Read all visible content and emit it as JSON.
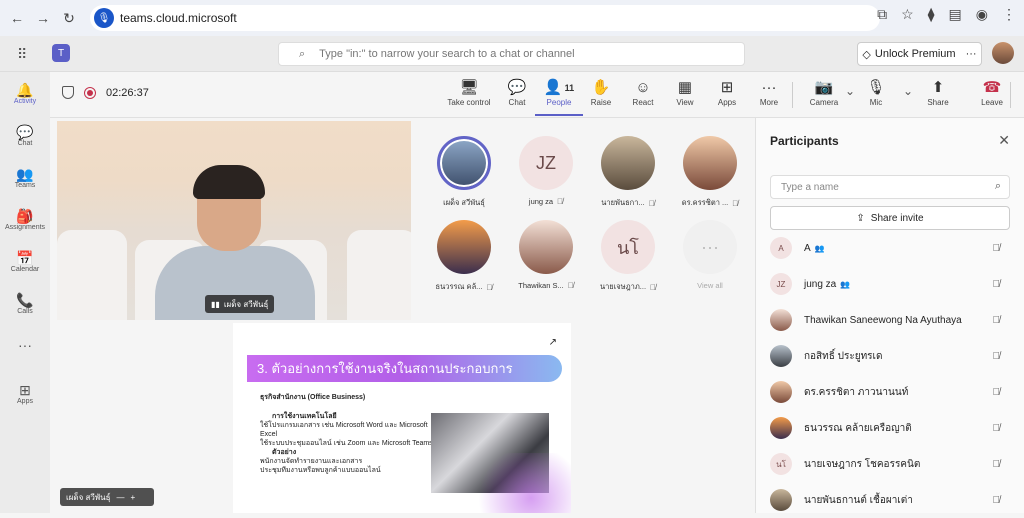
{
  "browser": {
    "url": "teams.cloud.microsoft",
    "nav_icons": [
      "back-icon",
      "forward-icon",
      "reload-icon"
    ],
    "right_icons": [
      "cast-icon",
      "star-icon",
      "extensions-icon",
      "tab-search-icon",
      "profile-icon",
      "menu-icon"
    ]
  },
  "teams": {
    "search_placeholder": "Type \"in:\" to narrow your search to a chat or channel",
    "premium_label": "Unlock Premium",
    "more_label": "···",
    "brand_color": "#5b5fc7"
  },
  "rail": [
    {
      "label": "Activity",
      "icon": "bell-icon",
      "glyph": "🔔",
      "active": true
    },
    {
      "label": "Chat",
      "icon": "chat-icon",
      "glyph": "💬",
      "active": false
    },
    {
      "label": "Teams",
      "icon": "teams-icon",
      "glyph": "👥",
      "active": false
    },
    {
      "label": "Assignments",
      "icon": "assignments-icon",
      "glyph": "🎒",
      "active": false
    },
    {
      "label": "Calendar",
      "icon": "calendar-icon",
      "glyph": "📅",
      "active": false
    },
    {
      "label": "Calls",
      "icon": "phone-icon",
      "glyph": "📞",
      "active": false
    },
    {
      "label": "",
      "icon": "more-apps-icon",
      "glyph": "···",
      "active": false
    },
    {
      "label": "Apps",
      "icon": "apps-icon",
      "glyph": "⊞",
      "active": false
    }
  ],
  "meeting": {
    "timer": "02:26:37",
    "people_count": "11",
    "tools": [
      {
        "label": "Take control",
        "icon": "take-control-icon",
        "glyph": "🖥"
      },
      {
        "label": "Chat",
        "icon": "chat-icon",
        "glyph": "💬"
      },
      {
        "label": "People",
        "icon": "people-icon",
        "glyph": "👤"
      },
      {
        "label": "Raise",
        "icon": "raise-hand-icon",
        "glyph": "✋"
      },
      {
        "label": "React",
        "icon": "react-icon",
        "glyph": "☺"
      },
      {
        "label": "View",
        "icon": "view-icon",
        "glyph": "▦"
      },
      {
        "label": "Apps",
        "icon": "apps-icon",
        "glyph": "⊞"
      },
      {
        "label": "More",
        "icon": "more-icon",
        "glyph": "···"
      },
      {
        "label": "Camera",
        "icon": "camera-off-icon",
        "glyph": "📷"
      },
      {
        "label": "Mic",
        "icon": "mic-off-icon",
        "glyph": "🎙"
      },
      {
        "label": "Share",
        "icon": "share-icon",
        "glyph": "⬆"
      },
      {
        "label": "Leave",
        "icon": "leave-phone-icon",
        "glyph": "☎"
      }
    ]
  },
  "stage": {
    "main_speaker_name": "เผด็จ สวีพันธุ์",
    "self_name": "เผด็จ สวีพันธุ์",
    "gallery": [
      {
        "name": "เผด็จ สวีพันธุ์",
        "initials": "",
        "selected": true,
        "muted": false
      },
      {
        "name": "jung za",
        "initials": "JZ",
        "selected": false,
        "muted": true
      },
      {
        "name": "นายพันธกา...",
        "initials": "",
        "selected": false,
        "muted": true
      },
      {
        "name": "ดร.ครรชิตา ...",
        "initials": "",
        "selected": false,
        "muted": true
      },
      {
        "name": "ธนวรรณ คล้...",
        "initials": "",
        "selected": false,
        "muted": true
      },
      {
        "name": "Thawikan S...",
        "initials": "",
        "selected": false,
        "muted": true
      },
      {
        "name": "นายเจษฎาภ...",
        "initials": "นโ",
        "selected": false,
        "muted": true
      },
      {
        "name": "View all",
        "initials": "···",
        "selected": false,
        "muted": false
      }
    ],
    "slide": {
      "title": "3. ตัวอย่างการใช้งานจริงในสถานประกอบการ",
      "section": "ธุรกิจสำนักงาน (Office Business)",
      "h1": "การใช้งานเทคโนโลยี",
      "l1": "ใช้โปรแกรมเอกสาร เช่น Microsoft Word และ Microsoft Excel",
      "l2": "ใช้ระบบประชุมออนไลน์ เช่น Zoom และ Microsoft Teams",
      "h2": "ตัวอย่าง",
      "l3": "พนักงานจัดทำรายงานและเอกสาร",
      "l4": "ประชุมทีมงานหรือพบลูกค้าแบบออนไลน์"
    }
  },
  "panel": {
    "title": "Participants",
    "search_placeholder": "Type a name",
    "share_invite": "Share invite",
    "participants": [
      {
        "name": "A",
        "initials": "A",
        "badge": true
      },
      {
        "name": "jung za",
        "initials": "JZ",
        "badge": true
      },
      {
        "name": "Thawikan Saneewong Na Ayuthaya",
        "initials": "",
        "badge": false
      },
      {
        "name": "กอสิทธิ์ ประยูทรเด",
        "initials": "",
        "badge": false
      },
      {
        "name": "ดร.ครรชิตา ภาวนานนท์",
        "initials": "",
        "badge": false
      },
      {
        "name": "ธนวรรณ คล้ายเครือญาติ",
        "initials": "",
        "badge": false
      },
      {
        "name": "นายเจษฎากร โชคอรรคนิต",
        "initials": "นโ",
        "badge": false
      },
      {
        "name": "นายพันธกานต์ เชื้อผาเต่า",
        "initials": "",
        "badge": false
      }
    ]
  }
}
